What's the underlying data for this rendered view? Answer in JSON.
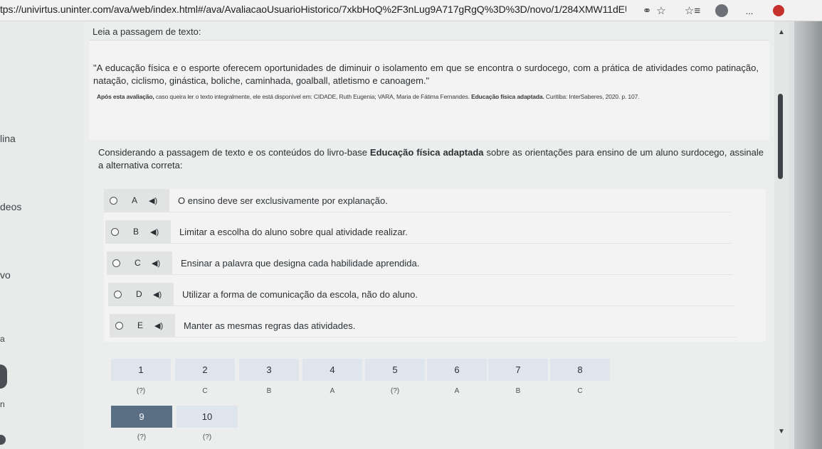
{
  "browser": {
    "url": "tps://univirtus.uninter.com/ava/web/index.html#/ava/AvaliacaoUsuarioHistorico/7xkbHoQ%2F3nLug9A717gRgQ%3D%3D/novo/1/284XMW11dEUA0...",
    "more_label": "..."
  },
  "sidebar": {
    "items": [
      {
        "label": "lina"
      },
      {
        "label": "deos"
      },
      {
        "label": "vo"
      },
      {
        "label": "a"
      },
      {
        "label": "n"
      }
    ]
  },
  "passage": {
    "label": "Leia a passagem de texto:",
    "quote": "\"A educação física e o esporte oferecem oportunidades de diminuir o isolamento em que se encontra o surdocego, com a prática de atividades como patinação, natação, ciclismo, ginástica, boliche, caminhada, goalball, atletismo e canoagem.\"",
    "source_prefix": "Após esta avaliação,",
    "source_rest": " caso queira ler o texto integralmente, ele está disponível em: CIDADE, Ruth Eugenia; VARA, Maria de Fátima Fernandes. ",
    "source_title": "Educação física adaptada.",
    "source_end": " Curitiba: InterSaberes, 2020. p. 107."
  },
  "question": {
    "text_before": "Considerando a passagem de texto e os conteúdos do livro-base ",
    "book": "Educação física adaptada",
    "text_after": " sobre as orientações para ensino de um aluno surdocego, assinale a alternativa correta:"
  },
  "options": [
    {
      "letter": "A",
      "text": "O ensino deve ser exclusivamente por explanação."
    },
    {
      "letter": "B",
      "text": "Limitar a escolha do aluno sobre qual atividade realizar."
    },
    {
      "letter": "C",
      "text": "Ensinar a palavra que designa cada habilidade aprendida."
    },
    {
      "letter": "D",
      "text": "Utilizar a forma de comunicação da escola, não do aluno."
    },
    {
      "letter": "E",
      "text": "Manter as mesmas regras das atividades."
    }
  ],
  "question_grid": [
    {
      "number": "1",
      "answer": "(?)"
    },
    {
      "number": "2",
      "answer": "C"
    },
    {
      "number": "3",
      "answer": "B"
    },
    {
      "number": "4",
      "answer": "A"
    },
    {
      "number": "5",
      "answer": "(?)"
    },
    {
      "number": "6",
      "answer": "A"
    },
    {
      "number": "7",
      "answer": "B"
    },
    {
      "number": "8",
      "answer": "C"
    },
    {
      "number": "9",
      "answer": "(?)"
    },
    {
      "number": "10",
      "answer": "(?)"
    }
  ],
  "active_question": "9",
  "icons": {
    "key": "key-icon",
    "star": "star-icon",
    "favorites": "favorites-icon",
    "profile": "profile-icon",
    "more": "more-icon",
    "speaker": "speaker-icon"
  },
  "colors": {
    "active_grid": "#5a6e84",
    "grid_cell": "#dfe5ec",
    "extension": "#c6312d"
  }
}
